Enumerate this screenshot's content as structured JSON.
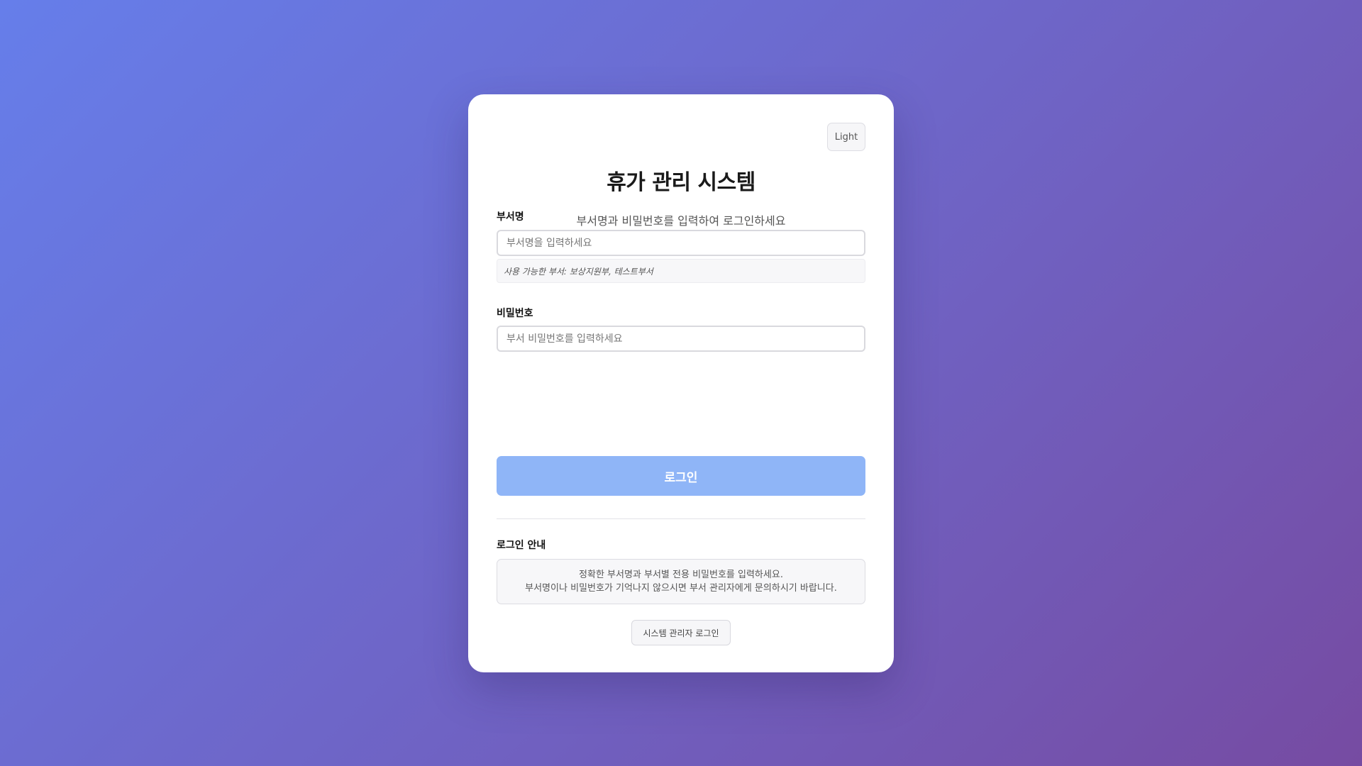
{
  "theme_toggle": {
    "label": "Light"
  },
  "header": {
    "title": "휴가 관리 시스템",
    "subtitle": "부서명과 비밀번호를 입력하여 로그인하세요"
  },
  "department": {
    "label": "부서명",
    "placeholder": "부서명을 입력하세요",
    "value": "",
    "hint": "사용 가능한 부서: 보상지원부, 테스트부서"
  },
  "password": {
    "label": "비밀번호",
    "placeholder": "부서 비밀번호를 입력하세요",
    "value": ""
  },
  "login_button": {
    "label": "로그인"
  },
  "guide": {
    "title": "로그인 안내",
    "lines": [
      "정확한 부서명과 부서별 전용 비밀번호를 입력하세요.",
      "부서명이나 비밀번호가 기억나지 않으시면 부서 관리자에게 문의하시기 바랍니다."
    ]
  },
  "admin_button": {
    "label": "시스템 관리자 로그인"
  },
  "colors": {
    "background_start": "#667eea",
    "background_end": "#764ba2",
    "login_button": "#8fb5f7",
    "card": "#ffffff"
  }
}
